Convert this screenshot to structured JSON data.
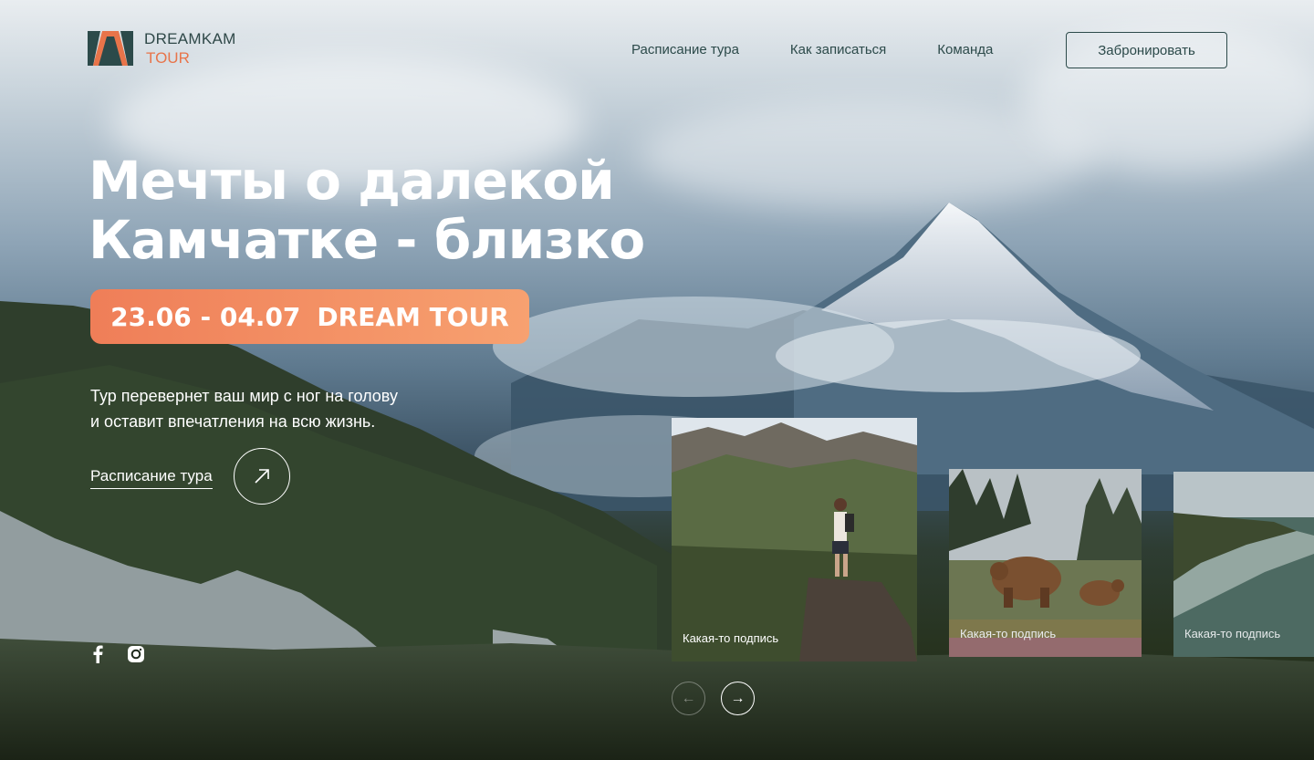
{
  "brand": {
    "line1": "DREAMKAM",
    "line2": "TOUR",
    "accent": "#e8744a",
    "dark": "#2c4a4a"
  },
  "nav": {
    "items": [
      {
        "label": "Расписание тура"
      },
      {
        "label": "Как записаться"
      },
      {
        "label": "Команда"
      }
    ],
    "book_label": "Забронировать"
  },
  "hero": {
    "title_line1": "Мечты о далекой",
    "title_line2": "Камчатке - близко",
    "badge_dates": "23.06 - 04.07",
    "badge_name": "DREAM TOUR",
    "lead_line1": "Тур перевернет ваш мир с ног на голову",
    "lead_line2": "и оставит впечатления на всю жизнь.",
    "link_label": "Расписание тура"
  },
  "social": {
    "icons": [
      "facebook-icon",
      "instagram-icon"
    ]
  },
  "gallery": {
    "cards": [
      {
        "caption": "Какая-то подпись",
        "icon": "hiker-photo"
      },
      {
        "caption": "Какая-то подпись",
        "icon": "bears-photo"
      },
      {
        "caption": "Какая-то подпись",
        "icon": "coast-photo"
      }
    ],
    "prev": "←",
    "next": "→"
  }
}
